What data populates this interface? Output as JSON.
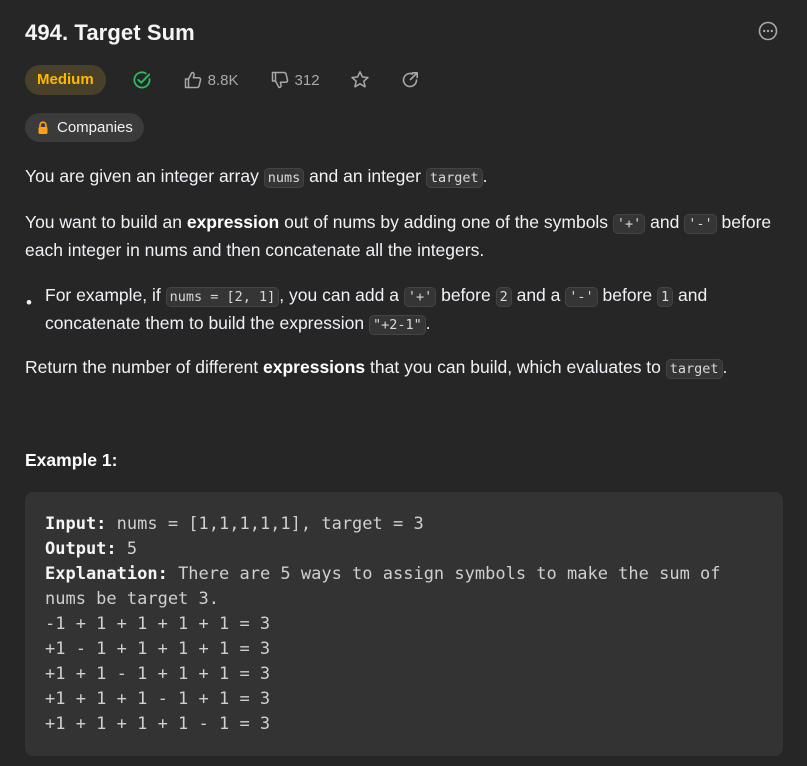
{
  "problem": {
    "title": "494. Target Sum",
    "difficulty": "Medium",
    "likes": "8.8K",
    "dislikes": "312",
    "companies_label": "Companies"
  },
  "colors": {
    "background": "#262626",
    "difficulty_text": "#ffb800",
    "difficulty_bg": "#49402a",
    "solved_check": "#2cbb5d",
    "code_block_bg": "#333333"
  },
  "icons": [
    "more-options-icon",
    "solved-check-icon",
    "thumbs-up-icon",
    "thumbs-down-icon",
    "star-icon",
    "share-icon",
    "lock-icon"
  ],
  "description": {
    "p1": {
      "t1": "You are given an integer array ",
      "c1": "nums",
      "t2": " and an integer ",
      "c2": "target",
      "t3": "."
    },
    "p2": {
      "t1": "You want to build an ",
      "b1": "expression",
      "t2": " out of nums by adding one of the symbols ",
      "c1": "'+'",
      "t3": " and ",
      "c2": "'-'",
      "t4": " before",
      "line2": "each integer in nums and then concatenate all the integers."
    },
    "bullet": {
      "t1": "For example, if ",
      "c1": "nums = [2, 1]",
      "t2": ", you can add a ",
      "c2": "'+'",
      "t3": " before ",
      "c3": "2",
      "t4": " and a ",
      "c4": "'-'",
      "t5": " before ",
      "c5": "1",
      "t6": " and",
      "line2": "concatenate them to build the expression ",
      "c6": "\"+2-1\"",
      "t7": "."
    },
    "p3": {
      "t1": "Return the number of different ",
      "b1": "expressions",
      "t2": " that you can build, which evaluates to ",
      "c1": "target",
      "t3": "."
    }
  },
  "example": {
    "title": "Example 1:",
    "input_label": "Input:",
    "input_value": " nums = [1,1,1,1,1], target = 3",
    "output_label": "Output:",
    "output_value": " 5",
    "explanation_label": "Explanation:",
    "explanation_value": " There are 5 ways to assign symbols to make the sum of",
    "explanation_line2": "nums be target 3.",
    "lines": [
      "-1 + 1 + 1 + 1 + 1 = 3",
      "+1 - 1 + 1 + 1 + 1 = 3",
      "+1 + 1 - 1 + 1 + 1 = 3",
      "+1 + 1 + 1 - 1 + 1 = 3",
      "+1 + 1 + 1 + 1 - 1 = 3"
    ]
  }
}
